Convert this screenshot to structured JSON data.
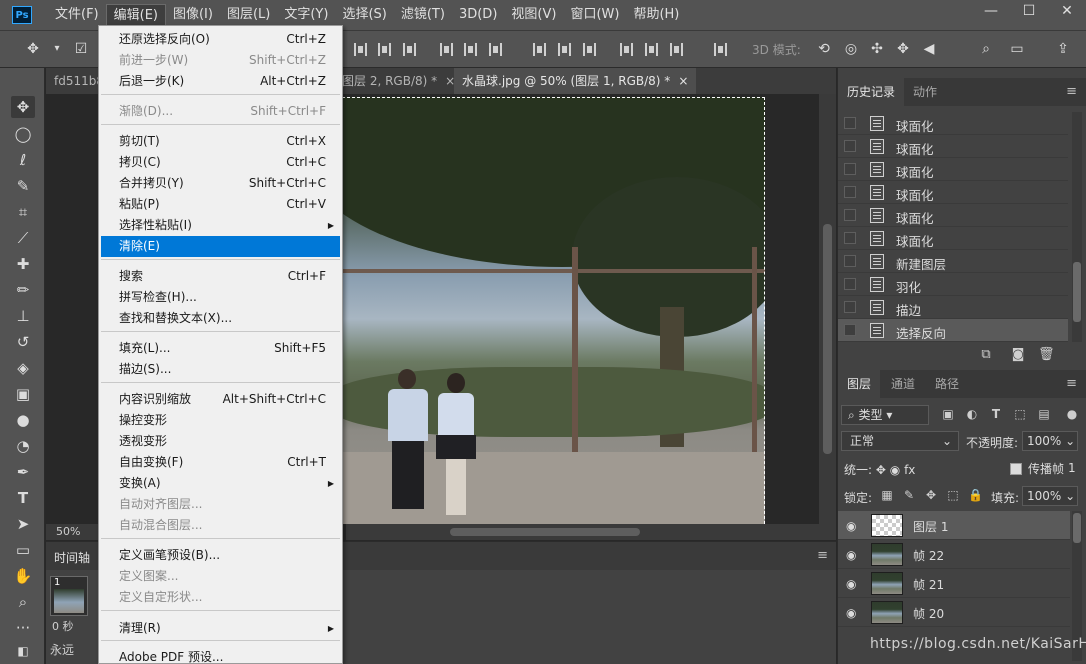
{
  "app": {
    "logo": "Ps",
    "menus": [
      "文件(F)",
      "编辑(E)",
      "图像(I)",
      "图层(L)",
      "文字(Y)",
      "选择(S)",
      "滤镜(T)",
      "3D(D)",
      "视图(V)",
      "窗口(W)",
      "帮助(H)"
    ],
    "active_menu": "编辑(E)",
    "window_controls": [
      "minimize-icon",
      "maximize-icon",
      "close-icon"
    ]
  },
  "options_bar": {
    "mode_3d_label": "3D 模式:"
  },
  "document_tabs": [
    {
      "label": "fd511b8",
      "active": false,
      "close": ""
    },
    {
      "label": "图层 2, RGB/8) *",
      "active": false,
      "close": "×"
    },
    {
      "label": "水晶球.jpg @ 50% (图层 1, RGB/8) *",
      "active": true,
      "close": "×"
    }
  ],
  "canvas": {
    "zoom": "50%"
  },
  "timeline": {
    "title": "时间轴",
    "frame_number": "1",
    "frame_time": "0 秒",
    "loop": "永远"
  },
  "edit_menu": {
    "items": [
      {
        "label": "还原选择反向(O)",
        "shortcut": "Ctrl+Z",
        "disabled": false
      },
      {
        "label": "前进一步(W)",
        "shortcut": "Shift+Ctrl+Z",
        "disabled": true
      },
      {
        "label": "后退一步(K)",
        "shortcut": "Alt+Ctrl+Z",
        "disabled": false
      },
      {
        "label": "渐隐(D)...",
        "shortcut": "Shift+Ctrl+F",
        "disabled": true
      },
      {
        "label": "剪切(T)",
        "shortcut": "Ctrl+X",
        "disabled": false
      },
      {
        "label": "拷贝(C)",
        "shortcut": "Ctrl+C",
        "disabled": false
      },
      {
        "label": "合并拷贝(Y)",
        "shortcut": "Shift+Ctrl+C",
        "disabled": false
      },
      {
        "label": "粘贴(P)",
        "shortcut": "Ctrl+V",
        "disabled": false
      },
      {
        "label": "选择性粘贴(I)",
        "shortcut": "",
        "disabled": false,
        "submenu": true
      },
      {
        "label": "清除(E)",
        "shortcut": "",
        "disabled": false,
        "highlighted": true
      },
      {
        "label": "搜索",
        "shortcut": "Ctrl+F",
        "disabled": false
      },
      {
        "label": "拼写检查(H)...",
        "shortcut": "",
        "disabled": false
      },
      {
        "label": "查找和替换文本(X)...",
        "shortcut": "",
        "disabled": false
      },
      {
        "label": "填充(L)...",
        "shortcut": "Shift+F5",
        "disabled": false
      },
      {
        "label": "描边(S)...",
        "shortcut": "",
        "disabled": false
      },
      {
        "label": "内容识别缩放",
        "shortcut": "Alt+Shift+Ctrl+C",
        "disabled": false
      },
      {
        "label": "操控变形",
        "shortcut": "",
        "disabled": false
      },
      {
        "label": "透视变形",
        "shortcut": "",
        "disabled": false
      },
      {
        "label": "自由变换(F)",
        "shortcut": "Ctrl+T",
        "disabled": false
      },
      {
        "label": "变换(A)",
        "shortcut": "",
        "disabled": false,
        "submenu": true
      },
      {
        "label": "自动对齐图层...",
        "shortcut": "",
        "disabled": true
      },
      {
        "label": "自动混合图层...",
        "shortcut": "",
        "disabled": true
      },
      {
        "label": "定义画笔预设(B)...",
        "shortcut": "",
        "disabled": false
      },
      {
        "label": "定义图案...",
        "shortcut": "",
        "disabled": true
      },
      {
        "label": "定义自定形状...",
        "shortcut": "",
        "disabled": true
      },
      {
        "label": "清理(R)",
        "shortcut": "",
        "disabled": false,
        "submenu": true
      },
      {
        "label": "Adobe PDF 预设...",
        "shortcut": "",
        "disabled": false
      }
    ]
  },
  "history_panel": {
    "tabs": [
      "历史记录",
      "动作"
    ],
    "items": [
      "球面化",
      "球面化",
      "球面化",
      "球面化",
      "球面化",
      "球面化",
      "新建图层",
      "羽化",
      "描边",
      "选择反向"
    ]
  },
  "layers_panel": {
    "tabs": [
      "图层",
      "通道",
      "路径"
    ],
    "filter": "类型",
    "blend_mode": "正常",
    "opacity_label": "不透明度:",
    "opacity": "100%",
    "unify_label": "统一:",
    "propagate_label": "传播帧",
    "propagate_frame": "1",
    "lock_label": "锁定:",
    "fill_label": "填充:",
    "fill": "100%",
    "layers": [
      {
        "name": "图层 1",
        "thumb": "transparent",
        "selected": true
      },
      {
        "name": "帧 22",
        "thumb": "photo",
        "selected": false
      },
      {
        "name": "帧 21",
        "thumb": "photo",
        "selected": false
      },
      {
        "name": "帧 20",
        "thumb": "photo",
        "selected": false
      }
    ]
  },
  "watermark": "https://blog.csdn.net/KaiSarH"
}
